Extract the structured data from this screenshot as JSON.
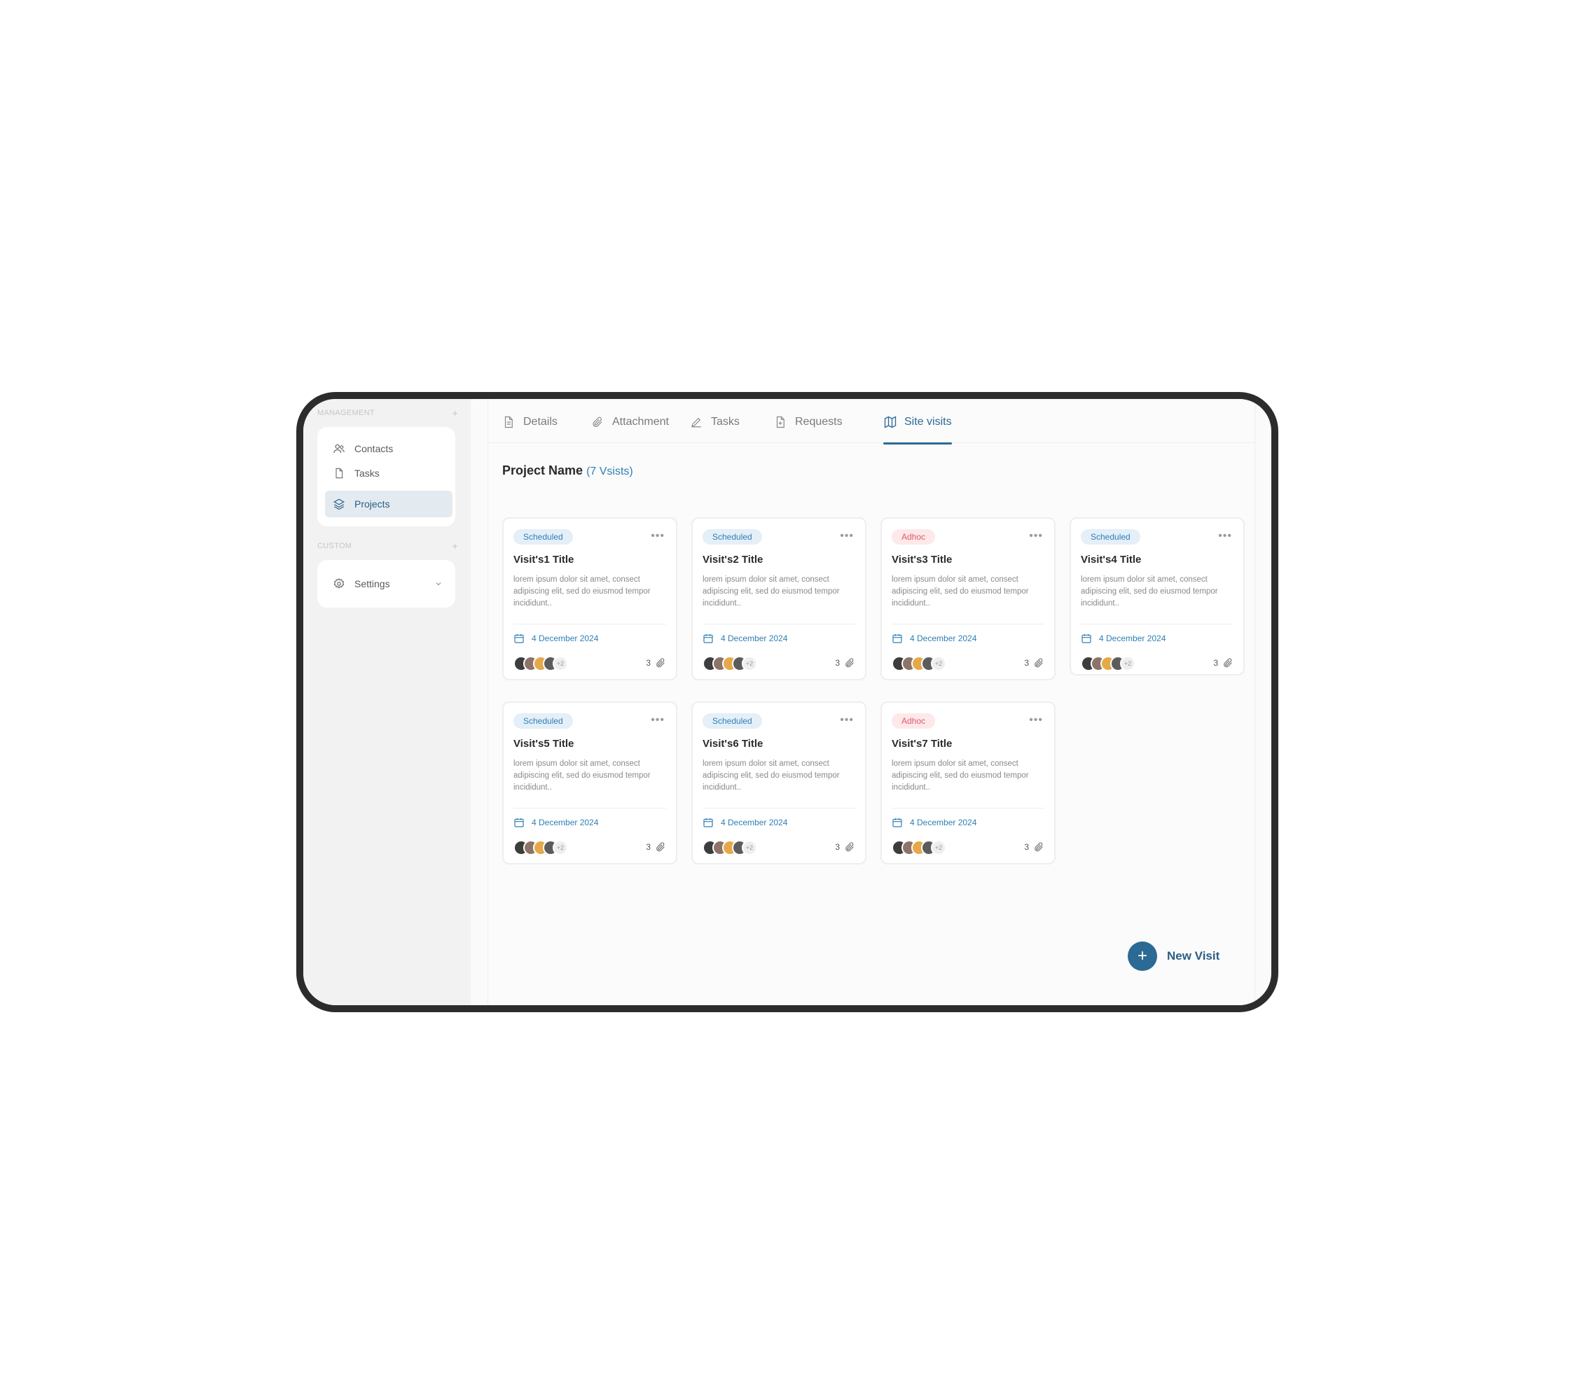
{
  "sidebar": {
    "sections": [
      {
        "title": "MANAGEMENT",
        "add": "+"
      },
      {
        "title": "CUSTOM",
        "add": "+"
      }
    ],
    "management_items": [
      {
        "label": "Contacts",
        "icon": "users-icon"
      },
      {
        "label": "Tasks",
        "icon": "file-icon"
      },
      {
        "label": "Projects",
        "icon": "layers-icon",
        "active": true
      }
    ],
    "custom_items": [
      {
        "label": "Settings",
        "icon": "gear-icon"
      }
    ]
  },
  "tabs": [
    {
      "label": "Details",
      "icon": "document-icon"
    },
    {
      "label": "Attachment",
      "icon": "paperclip-icon"
    },
    {
      "label": "Tasks",
      "icon": "pen-icon"
    },
    {
      "label": "Requests",
      "icon": "file-plus-icon"
    },
    {
      "label": "Site visits",
      "icon": "map-icon",
      "active": true
    }
  ],
  "project": {
    "name": "Project Name",
    "count_label": "(7 Vsists)"
  },
  "visits": [
    {
      "status": "Scheduled",
      "title": "Visit's1 Title",
      "desc": "lorem ipsum dolor sit amet, consect adipiscing elit, sed do eiusmod tempor incididunt..",
      "date": "4 December 2024",
      "more": "+2",
      "attachments": "3"
    },
    {
      "status": "Scheduled",
      "title": "Visit's2 Title",
      "desc": "lorem ipsum dolor sit amet, consect adipiscing elit, sed do eiusmod tempor incididunt..",
      "date": "4 December 2024",
      "more": "+2",
      "attachments": "3"
    },
    {
      "status": "Adhoc",
      "title": "Visit's3 Title",
      "desc": "lorem ipsum dolor sit amet, consect adipiscing elit, sed do eiusmod tempor incididunt..",
      "date": "4 December 2024",
      "more": "+2",
      "attachments": "3"
    },
    {
      "status": "Scheduled",
      "title": "Visit's4 Title",
      "desc": "lorem ipsum dolor sit amet, consect adipiscing elit, sed do eiusmod tempor incididunt..",
      "date": "4 December 2024",
      "more": "+2",
      "attachments": "3"
    },
    {
      "status": "Scheduled",
      "title": "Visit's5 Title",
      "desc": "lorem ipsum dolor sit amet, consect adipiscing elit, sed do eiusmod tempor incididunt..",
      "date": "4 December 2024",
      "more": "+2",
      "attachments": "3"
    },
    {
      "status": "Scheduled",
      "title": "Visit's6 Title",
      "desc": "lorem ipsum dolor sit amet, consect adipiscing elit, sed do eiusmod tempor incididunt..",
      "date": "4 December 2024",
      "more": "+2",
      "attachments": "3"
    },
    {
      "status": "Adhoc",
      "title": "Visit's7 Title",
      "desc": "lorem ipsum dolor sit amet, consect adipiscing elit, sed do eiusmod tempor incididunt..",
      "date": "4 December 2024",
      "more": "+2",
      "attachments": "3"
    }
  ],
  "new_visit": {
    "icon": "+",
    "label": "New Visit"
  },
  "colors": {
    "accent": "#2b6a94",
    "link": "#2f7fb5",
    "scheduled_bg": "#e4eff8",
    "adhoc_bg": "#fde8ea",
    "adhoc_text": "#e05a66",
    "avatars": [
      "#3d3d3d",
      "#8c7468",
      "#e5a94a",
      "#5c5c5c"
    ]
  }
}
